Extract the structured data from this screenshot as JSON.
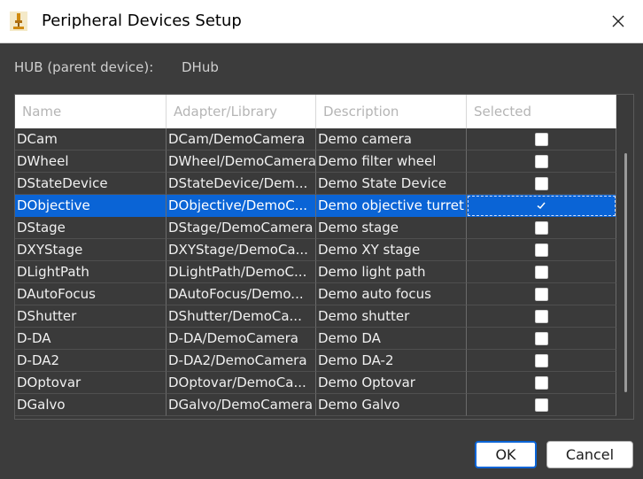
{
  "window": {
    "title": "Peripheral Devices Setup",
    "app_icon": "microscope-icon",
    "close_icon": "close-icon"
  },
  "hub": {
    "label": "HUB (parent device):",
    "value": "DHub"
  },
  "table": {
    "columns": [
      "Name",
      "Adapter/Library",
      "Description",
      "Selected"
    ],
    "rows": [
      {
        "name": "DCam",
        "adapter": "DCam/DemoCamera",
        "description": "Demo camera",
        "selected": false
      },
      {
        "name": "DWheel",
        "adapter": "DWheel/DemoCamera",
        "description": "Demo filter wheel",
        "selected": false
      },
      {
        "name": "DStateDevice",
        "adapter": "DStateDevice/Dem...",
        "description": "Demo State Device",
        "selected": false
      },
      {
        "name": "DObjective",
        "adapter": "DObjective/DemoC...",
        "description": "Demo objective turret",
        "selected": true
      },
      {
        "name": "DStage",
        "adapter": "DStage/DemoCamera",
        "description": "Demo stage",
        "selected": false
      },
      {
        "name": "DXYStage",
        "adapter": "DXYStage/DemoCa...",
        "description": "Demo XY stage",
        "selected": false
      },
      {
        "name": "DLightPath",
        "adapter": "DLightPath/DemoC...",
        "description": "Demo light path",
        "selected": false
      },
      {
        "name": "DAutoFocus",
        "adapter": "DAutoFocus/Demo...",
        "description": "Demo auto focus",
        "selected": false
      },
      {
        "name": "DShutter",
        "adapter": "DShutter/DemoCa...",
        "description": "Demo shutter",
        "selected": false
      },
      {
        "name": "D-DA",
        "adapter": "D-DA/DemoCamera",
        "description": "Demo DA",
        "selected": false
      },
      {
        "name": "D-DA2",
        "adapter": "D-DA2/DemoCamera",
        "description": "Demo DA-2",
        "selected": false
      },
      {
        "name": "DOptovar",
        "adapter": "DOptovar/DemoCa...",
        "description": "Demo Optovar",
        "selected": false
      },
      {
        "name": "DGalvo",
        "adapter": "DGalvo/DemoCamera",
        "description": "Demo Galvo",
        "selected": false
      }
    ],
    "highlighted_row": 3
  },
  "buttons": {
    "ok": "OK",
    "cancel": "Cancel"
  },
  "colors": {
    "selection": "#0a64d6",
    "background": "#3c3c3c"
  }
}
